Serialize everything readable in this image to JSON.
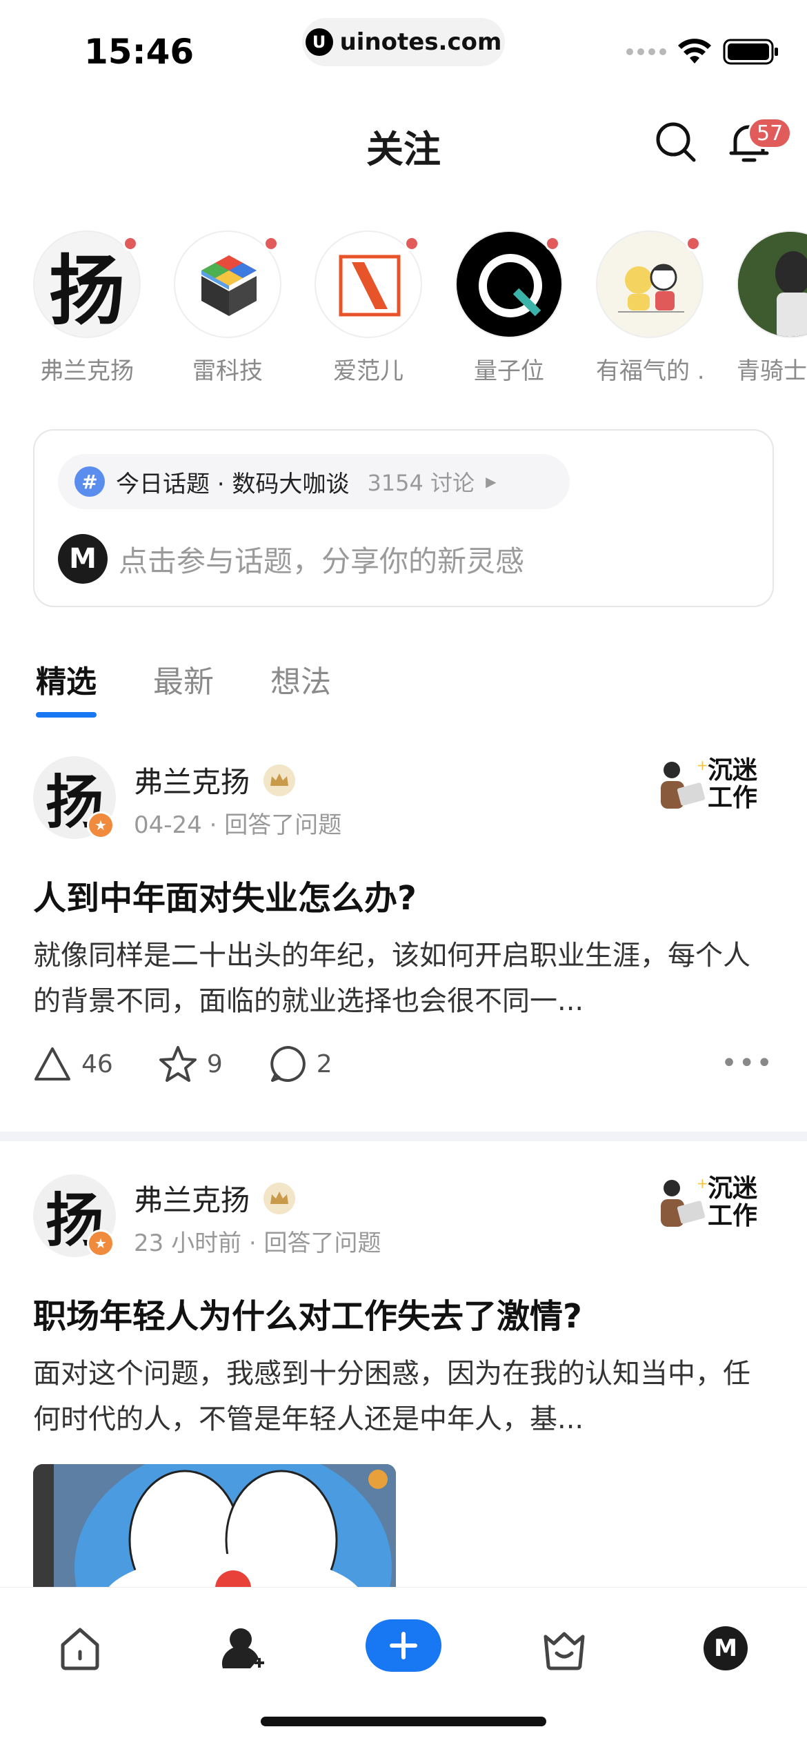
{
  "status_bar": {
    "time": "15:46",
    "url": "uinotes.com"
  },
  "header": {
    "title": "关注",
    "notification_count": "57"
  },
  "following": [
    {
      "name": "弗兰克扬"
    },
    {
      "name": "雷科技"
    },
    {
      "name": "爱范儿"
    },
    {
      "name": "量子位"
    },
    {
      "name": "有福气的 ..."
    },
    {
      "name": "青骑士"
    }
  ],
  "topic": {
    "label": "今日话题 · 数码大咖谈",
    "count": "3154 讨论",
    "placeholder": "点击参与话题，分享你的新灵感"
  },
  "tabs": [
    {
      "label": "精选",
      "active": true
    },
    {
      "label": "最新",
      "active": false
    },
    {
      "label": "想法",
      "active": false
    }
  ],
  "posts": [
    {
      "author": "弗兰克扬",
      "meta": "04-24 · 回答了问题",
      "tag": "沉迷工作",
      "title": "人到中年面对失业怎么办?",
      "body": "就像同样是二十出头的年纪，该如何开启职业生涯，每个人的背景不同，面临的就业选择也会很不同一...",
      "likes": "46",
      "stars": "9",
      "comments": "2"
    },
    {
      "author": "弗兰克扬",
      "meta": "23 小时前 · 回答了问题",
      "tag": "沉迷工作",
      "title": "职场年轻人为什么对工作失去了激情?",
      "body": "面对这个问题，我感到十分困惑，因为在我的认知当中，任何时代的人，不管是年轻人还是中年人，基..."
    }
  ],
  "avatar_glyph": "扬",
  "colors": {
    "accent": "#1877f2",
    "badge": "#e15b5b"
  }
}
